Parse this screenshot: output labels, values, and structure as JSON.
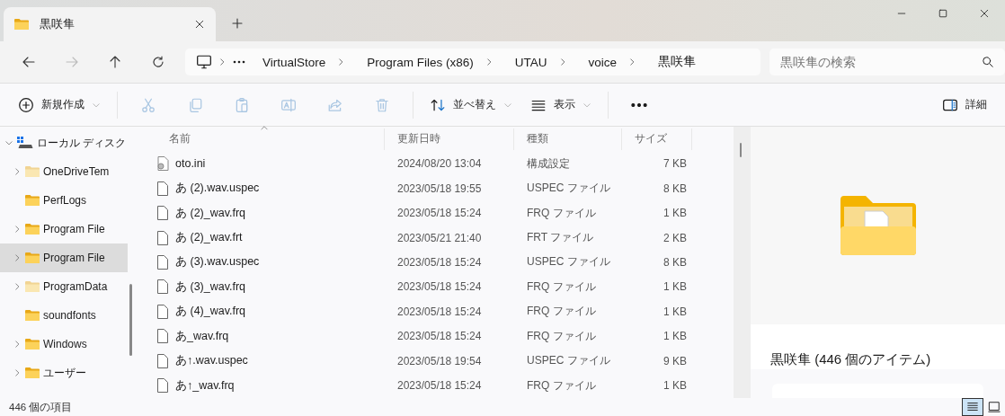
{
  "tab": {
    "title": "黒咲隼"
  },
  "nav_buttons": [
    {
      "kind": "back",
      "disabled": false
    },
    {
      "kind": "forward",
      "disabled": true
    },
    {
      "kind": "up",
      "disabled": false
    },
    {
      "kind": "refresh",
      "disabled": false
    }
  ],
  "breadcrumb": [
    "VirtualStore",
    "Program Files (x86)",
    "UTAU",
    "voice",
    "黒咲隼"
  ],
  "search": {
    "placeholder": "黒咲隼の検索"
  },
  "toolbar": [
    [
      {
        "kind": "new",
        "label": "新規作成",
        "dropdown": true,
        "disabled": false
      }
    ],
    [
      {
        "kind": "cut",
        "disabled": true
      },
      {
        "kind": "copy",
        "disabled": true
      },
      {
        "kind": "paste",
        "disabled": true
      },
      {
        "kind": "rename",
        "disabled": true
      },
      {
        "kind": "share",
        "disabled": true
      },
      {
        "kind": "delete",
        "disabled": true
      }
    ],
    [
      {
        "kind": "sort",
        "label": "並べ替え",
        "dropdown": true,
        "disabled": false
      },
      {
        "kind": "view",
        "label": "表示",
        "dropdown": true,
        "disabled": false
      }
    ],
    [
      {
        "kind": "more",
        "disabled": false
      }
    ]
  ],
  "details_button": {
    "label": "詳細"
  },
  "sidebar": {
    "items": [
      {
        "label": "ローカル ディスク",
        "kind": "drive",
        "expanded": true,
        "selected": false,
        "hidden": false,
        "children": [
          {
            "label": "OneDriveTem",
            "kind": "folder",
            "expanded": false,
            "selected": false,
            "hidden": true
          },
          {
            "label": "PerfLogs",
            "kind": "folder",
            "selected": false,
            "hidden": false
          },
          {
            "label": "Program File",
            "kind": "folder",
            "expanded": false,
            "selected": false,
            "hidden": false
          },
          {
            "label": "Program File",
            "kind": "folder",
            "expanded": false,
            "selected": true,
            "hidden": false
          },
          {
            "label": "ProgramData",
            "kind": "folder",
            "expanded": false,
            "selected": false,
            "hidden": true
          },
          {
            "label": "soundfonts",
            "kind": "folder",
            "selected": false,
            "hidden": false
          },
          {
            "label": "Windows",
            "kind": "folder",
            "expanded": false,
            "selected": false,
            "hidden": false
          },
          {
            "label": "ユーザー",
            "kind": "folder",
            "expanded": false,
            "selected": false,
            "hidden": false
          }
        ]
      }
    ]
  },
  "table": {
    "columns": [
      {
        "label": "名前",
        "sorted": true
      },
      {
        "label": "更新日時",
        "sorted": false
      },
      {
        "label": "種類",
        "sorted": false
      },
      {
        "label": "サイズ",
        "sorted": false
      }
    ],
    "rows": [
      {
        "kind": "config",
        "name": "oto.ini",
        "date": "2024/08/20 13:04",
        "type": "構成設定",
        "size": "7 KB"
      },
      {
        "kind": "file",
        "name": "あ (2).wav.uspec",
        "date": "2023/05/18 19:55",
        "type": "USPEC ファイル",
        "size": "8 KB"
      },
      {
        "kind": "file",
        "name": "あ (2)_wav.frq",
        "date": "2023/05/18 15:24",
        "type": "FRQ ファイル",
        "size": "1 KB"
      },
      {
        "kind": "file",
        "name": "あ (2)_wav.frt",
        "date": "2023/05/21 21:40",
        "type": "FRT ファイル",
        "size": "2 KB"
      },
      {
        "kind": "file",
        "name": "あ (3).wav.uspec",
        "date": "2023/05/18 15:24",
        "type": "USPEC ファイル",
        "size": "8 KB"
      },
      {
        "kind": "file",
        "name": "あ (3)_wav.frq",
        "date": "2023/05/18 15:24",
        "type": "FRQ ファイル",
        "size": "1 KB"
      },
      {
        "kind": "file",
        "name": "あ (4)_wav.frq",
        "date": "2023/05/18 15:24",
        "type": "FRQ ファイル",
        "size": "1 KB"
      },
      {
        "kind": "file",
        "name": "あ_wav.frq",
        "date": "2023/05/18 15:24",
        "type": "FRQ ファイル",
        "size": "1 KB"
      },
      {
        "kind": "file",
        "name": "あ↑.wav.uspec",
        "date": "2023/05/18 19:54",
        "type": "USPEC ファイル",
        "size": "9 KB"
      },
      {
        "kind": "file",
        "name": "あ↑_wav.frq",
        "date": "2023/05/18 15:24",
        "type": "FRQ ファイル",
        "size": "1 KB"
      }
    ]
  },
  "details": {
    "title": "黒咲隼 (446 個のアイテム)"
  },
  "status_bar": {
    "count": "446 個の項目",
    "views": [
      {
        "kind": "details",
        "selected": true
      },
      {
        "kind": "tiles",
        "selected": false
      }
    ]
  }
}
